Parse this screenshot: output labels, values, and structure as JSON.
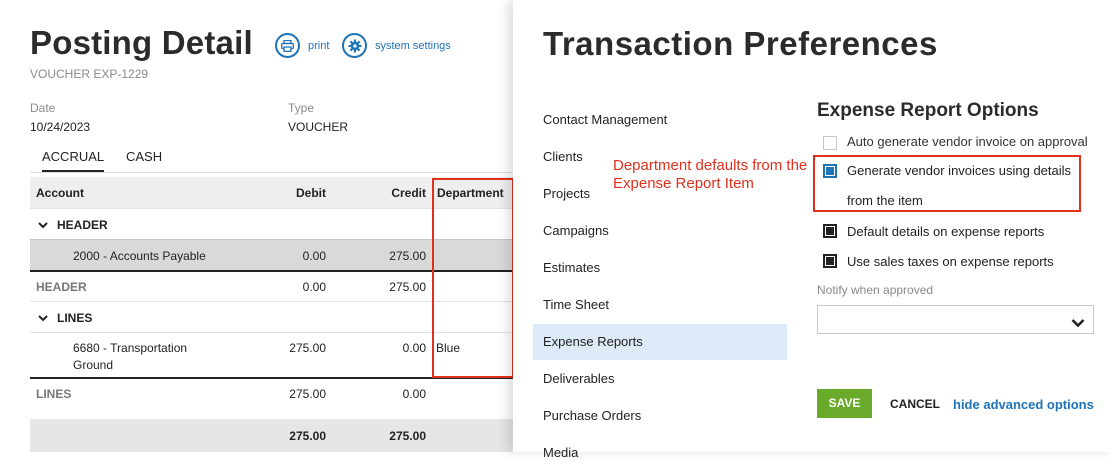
{
  "posting": {
    "title": "Posting Detail",
    "subtitle": "VOUCHER EXP-1229",
    "print_label": "print",
    "settings_label": "system settings",
    "date_label": "Date",
    "date_value": "10/24/2023",
    "type_label": "Type",
    "type_value": "VOUCHER",
    "tabs": [
      "ACCRUAL",
      "CASH"
    ],
    "columns": [
      "Account",
      "Debit",
      "Credit",
      "Department"
    ],
    "rows": {
      "header_group": "HEADER",
      "header_item_account": "2000 - Accounts Payable",
      "header_item_debit": "0.00",
      "header_item_credit": "275.00",
      "header_total_label": "HEADER",
      "header_total_debit": "0.00",
      "header_total_credit": "275.00",
      "lines_group": "LINES",
      "lines_item_account_1": "6680 - Transportation",
      "lines_item_account_2": "Ground",
      "lines_item_debit": "275.00",
      "lines_item_credit": "0.00",
      "lines_item_department": "Blue",
      "lines_total_label": "LINES",
      "lines_total_debit": "275.00",
      "lines_total_credit": "0.00",
      "grand_debit": "275.00",
      "grand_credit": "275.00"
    }
  },
  "prefs": {
    "title": "Transaction Preferences",
    "nav": [
      "Contact Management",
      "Clients",
      "Projects",
      "Campaigns",
      "Estimates",
      "Time Sheet",
      "Expense Reports",
      "Deliverables",
      "Purchase Orders",
      "Media"
    ],
    "annotation_line1": "Department defaults from the",
    "annotation_line2": "Expense Report Item",
    "section_title": "Expense Report Options",
    "options": {
      "auto_generate": "Auto generate vendor invoice on approval",
      "generate_details_1": "Generate vendor invoices using details",
      "generate_details_2": "from the item",
      "default_details": "Default details on expense reports",
      "sales_taxes": "Use sales taxes on expense reports"
    },
    "notify_label": "Notify when approved",
    "notify_value": "",
    "save_label": "SAVE",
    "cancel_label": "CANCEL",
    "hide_label": "hide advanced options"
  },
  "colors": {
    "accent_blue": "#1f73b7",
    "save_green": "#6aaa2a",
    "annotation_red": "#e0301e",
    "nav_active": "#dcebf7"
  }
}
